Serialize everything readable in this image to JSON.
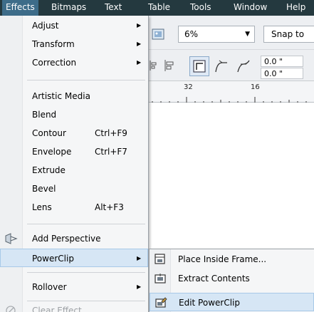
{
  "menubar": {
    "items": [
      "Effects",
      "Bitmaps",
      "Text",
      "Table",
      "Tools",
      "Window",
      "Help"
    ]
  },
  "toolbar": {
    "zoom_value": "6%",
    "snap_label": "Snap to",
    "nudge_x": "0.0 \"",
    "nudge_y": "0.0 \""
  },
  "ruler": {
    "labels": [
      "32",
      "16"
    ]
  },
  "effects_menu": {
    "items": [
      {
        "label": "Adjust",
        "shortcut": "",
        "submenu": true
      },
      {
        "label": "Transform",
        "shortcut": "",
        "submenu": true
      },
      {
        "label": "Correction",
        "shortcut": "",
        "submenu": true
      },
      {
        "label": "Artistic Media",
        "shortcut": "",
        "submenu": false
      },
      {
        "label": "Blend",
        "shortcut": "",
        "submenu": false
      },
      {
        "label": "Contour",
        "shortcut": "Ctrl+F9",
        "submenu": false
      },
      {
        "label": "Envelope",
        "shortcut": "Ctrl+F7",
        "submenu": false
      },
      {
        "label": "Extrude",
        "shortcut": "",
        "submenu": false
      },
      {
        "label": "Bevel",
        "shortcut": "",
        "submenu": false
      },
      {
        "label": "Lens",
        "shortcut": "Alt+F3",
        "submenu": false
      },
      {
        "label": "Add Perspective",
        "shortcut": "",
        "submenu": false
      },
      {
        "label": "PowerClip",
        "shortcut": "",
        "submenu": true
      },
      {
        "label": "Rollover",
        "shortcut": "",
        "submenu": true
      },
      {
        "label": "Clear Effect",
        "shortcut": "",
        "submenu": false
      }
    ]
  },
  "powerclip_submenu": {
    "items": [
      {
        "label": "Place Inside Frame..."
      },
      {
        "label": "Extract Contents"
      },
      {
        "label": "Edit PowerClip"
      }
    ]
  },
  "colors": {
    "menubar_bg": "#24393f",
    "menubar_active": "#3d6c89",
    "menu_bg": "#f5f6f7",
    "hover_bg": "#d6e6f5",
    "hover_border": "#a8c9e8",
    "disabled_text": "#9da1a5"
  }
}
